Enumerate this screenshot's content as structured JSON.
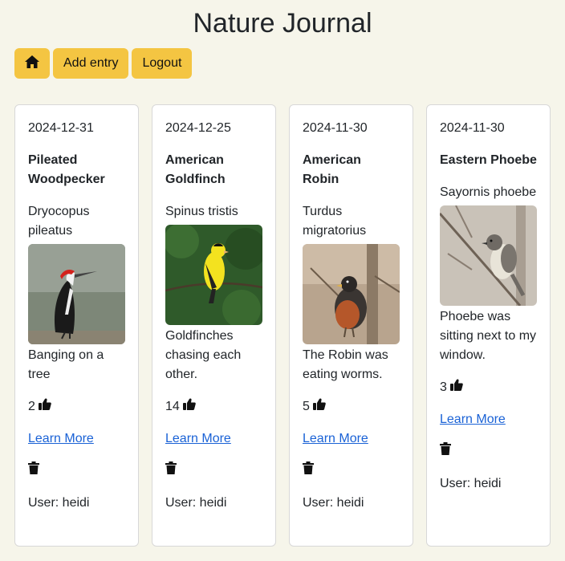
{
  "app": {
    "title": "Nature Journal"
  },
  "nav": {
    "home_icon": "home-icon",
    "add_label": "Add entry",
    "logout_label": "Logout"
  },
  "entries": [
    {
      "date": "2024-12-31",
      "name": "Pileated Woodpecker",
      "scientific": "Dryocopus pileatus",
      "note": "Banging on a tree",
      "likes": "2",
      "learn_more": "Learn More",
      "user": "User: heidi"
    },
    {
      "date": "2024-12-25",
      "name": "American Goldfinch",
      "scientific": "Spinus tristis",
      "note": "Goldfinches chasing each other.",
      "likes": "14",
      "learn_more": "Learn More",
      "user": "User: heidi"
    },
    {
      "date": "2024-11-30",
      "name": "American Robin",
      "scientific": "Turdus migratorius",
      "note": "The Robin was eating worms.",
      "likes": "5",
      "learn_more": "Learn More",
      "user": "User: heidi"
    },
    {
      "date": "2024-11-30",
      "name": "Eastern Phoebe",
      "scientific": "Sayornis phoebe",
      "note": "Phoebe was sitting next to my window.",
      "likes": "3",
      "learn_more": "Learn More",
      "user": "User: heidi"
    }
  ],
  "colors": {
    "accent": "#f4c542",
    "background": "#f6f5ea",
    "link": "#1a62d6"
  }
}
